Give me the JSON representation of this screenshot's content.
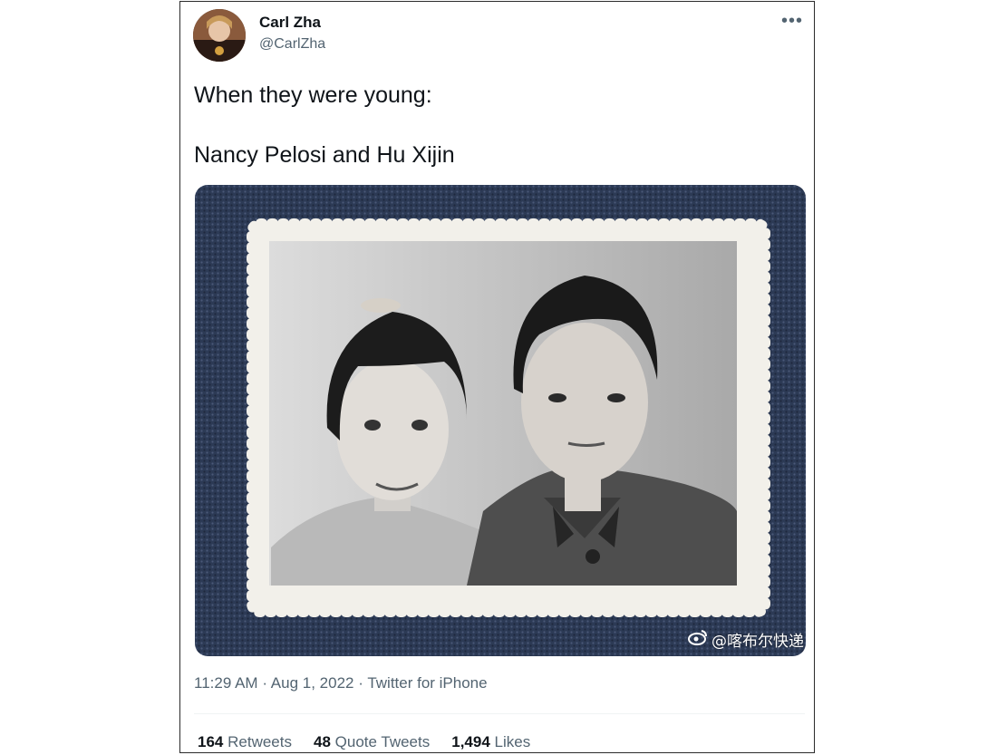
{
  "author": {
    "name": "Carl Zha",
    "handle": "@CarlZha"
  },
  "tweet": {
    "lines": [
      "When they were young:",
      "Nancy Pelosi and Hu Xijin"
    ],
    "watermark": "@喀布尔快递"
  },
  "meta": {
    "time": "11:29 AM",
    "date": "Aug 1, 2022",
    "client": "Twitter for iPhone",
    "separator": "·"
  },
  "stats": {
    "retweets": {
      "count": "164",
      "label": "Retweets"
    },
    "quotes": {
      "count": "48",
      "label": "Quote Tweets"
    },
    "likes": {
      "count": "1,494",
      "label": "Likes"
    }
  },
  "icons": {
    "menu": "more-horizontal-icon",
    "watermark": "weibo-icon"
  }
}
